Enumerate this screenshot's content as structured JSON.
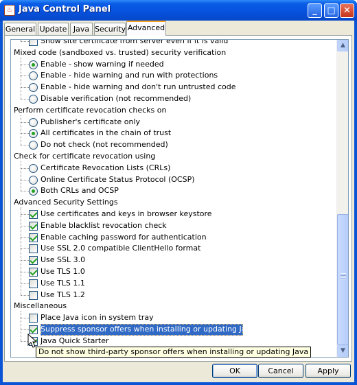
{
  "window": {
    "title": "Java Control Panel",
    "icon": "java-icon",
    "controls": {
      "minimize": "_",
      "maximize": "□",
      "close": "✕"
    }
  },
  "tabs": [
    "General",
    "Update",
    "Java",
    "Security",
    "Advanced"
  ],
  "active_tab": "Advanced",
  "tree": {
    "partial_top_item": {
      "label": "Show site certificate from server even if it is valid",
      "checked": false
    },
    "groups": [
      {
        "title": "Mixed code (sandboxed vs. trusted) security verification",
        "items": [
          {
            "type": "radio",
            "label": "Enable - show warning if needed",
            "checked": true
          },
          {
            "type": "radio",
            "label": "Enable - hide warning and run with protections",
            "checked": false
          },
          {
            "type": "radio",
            "label": "Enable - hide warning and don't run untrusted code",
            "checked": false
          },
          {
            "type": "radio",
            "label": "Disable verification (not recommended)",
            "checked": false
          }
        ]
      },
      {
        "title": "Perform certificate revocation checks on",
        "items": [
          {
            "type": "radio",
            "label": "Publisher's certificate only",
            "checked": false
          },
          {
            "type": "radio",
            "label": "All certificates in the chain of trust",
            "checked": true
          },
          {
            "type": "radio",
            "label": "Do not check (not recommended)",
            "checked": false
          }
        ]
      },
      {
        "title": "Check for certificate revocation using",
        "items": [
          {
            "type": "radio",
            "label": "Certificate Revocation Lists (CRLs)",
            "checked": false
          },
          {
            "type": "radio",
            "label": "Online Certificate Status Protocol (OCSP)",
            "checked": false
          },
          {
            "type": "radio",
            "label": "Both CRLs and OCSP",
            "checked": true
          }
        ]
      },
      {
        "title": "Advanced Security Settings",
        "items": [
          {
            "type": "check",
            "label": "Use certificates and keys in browser keystore",
            "checked": true
          },
          {
            "type": "check",
            "label": "Enable blacklist revocation check",
            "checked": true
          },
          {
            "type": "check",
            "label": "Enable caching password for authentication",
            "checked": true
          },
          {
            "type": "check",
            "label": "Use SSL 2.0 compatible ClientHello format",
            "checked": false
          },
          {
            "type": "check",
            "label": "Use SSL 3.0",
            "checked": true
          },
          {
            "type": "check",
            "label": "Use TLS 1.0",
            "checked": true
          },
          {
            "type": "check",
            "label": "Use TLS 1.1",
            "checked": false
          },
          {
            "type": "check",
            "label": "Use TLS 1.2",
            "checked": false
          }
        ]
      },
      {
        "title": "Miscellaneous",
        "items": [
          {
            "type": "check",
            "label": "Place Java icon in system tray",
            "checked": false
          },
          {
            "type": "check",
            "label": "Suppress sponsor offers when installing or updating Java",
            "checked": true,
            "selected": true
          },
          {
            "type": "check",
            "label": "Java Quick Starter",
            "checked": true
          }
        ]
      }
    ]
  },
  "tooltip": "Do not show third-party sponsor offers when installing or updating Java",
  "buttons": {
    "ok": "OK",
    "cancel": "Cancel",
    "apply": "Apply"
  },
  "colors": {
    "titlebar": "#0a5ce6",
    "selection": "#316ac5",
    "dialog_bg": "#ece9d8",
    "check_mark": "#21a121"
  }
}
